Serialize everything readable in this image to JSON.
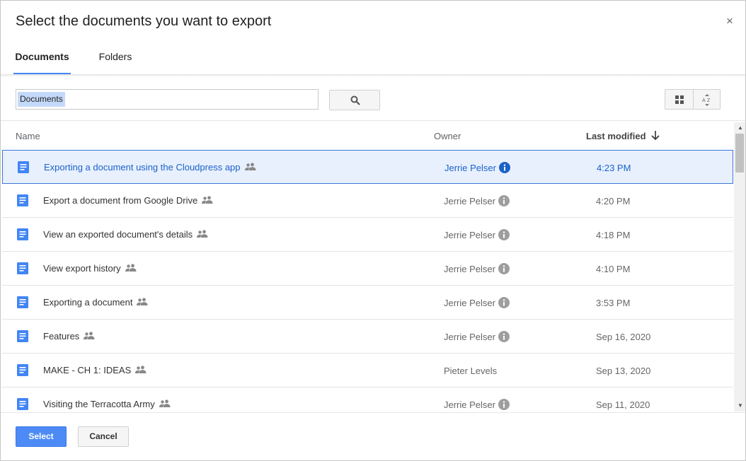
{
  "dialog": {
    "title": "Select the documents you want to export",
    "close_label": "×"
  },
  "tabs": [
    {
      "label": "Documents",
      "active": true
    },
    {
      "label": "Folders",
      "active": false
    }
  ],
  "search": {
    "value": "Documents",
    "button_icon": "search-icon"
  },
  "view_controls": {
    "grid_icon": "grid-view-icon",
    "sort_icon": "sort-az-icon"
  },
  "columns": {
    "name": "Name",
    "owner": "Owner",
    "last_modified": "Last modified",
    "sort_icon": "arrow-down-icon"
  },
  "rows": [
    {
      "name": "Exporting a document using the Cloudpress app",
      "owner": "Jerrie Pelser",
      "modified": "4:23 PM",
      "selected": true,
      "shared": true,
      "info": true
    },
    {
      "name": "Export a document from Google Drive",
      "owner": "Jerrie Pelser",
      "modified": "4:20 PM",
      "selected": false,
      "shared": true,
      "info": true
    },
    {
      "name": "View an exported document's details",
      "owner": "Jerrie Pelser",
      "modified": "4:18 PM",
      "selected": false,
      "shared": true,
      "info": true
    },
    {
      "name": "View export history",
      "owner": "Jerrie Pelser",
      "modified": "4:10 PM",
      "selected": false,
      "shared": true,
      "info": true
    },
    {
      "name": "Exporting a document",
      "owner": "Jerrie Pelser",
      "modified": "3:53 PM",
      "selected": false,
      "shared": true,
      "info": true
    },
    {
      "name": "Features",
      "owner": "Jerrie Pelser",
      "modified": "Sep 16, 2020",
      "selected": false,
      "shared": true,
      "info": true
    },
    {
      "name": "MAKE - CH 1: IDEAS",
      "owner": "Pieter Levels",
      "modified": "Sep 13, 2020",
      "selected": false,
      "shared": true,
      "info": false
    },
    {
      "name": "Visiting the Terracotta Army",
      "owner": "Jerrie Pelser",
      "modified": "Sep 11, 2020",
      "selected": false,
      "shared": true,
      "info": true
    }
  ],
  "footer": {
    "select_label": "Select",
    "cancel_label": "Cancel"
  },
  "colors": {
    "accent": "#4285f4",
    "selected_row_bg": "#e8f0fe",
    "selected_text": "#1a62c8",
    "doc_icon": "#4285f4"
  }
}
